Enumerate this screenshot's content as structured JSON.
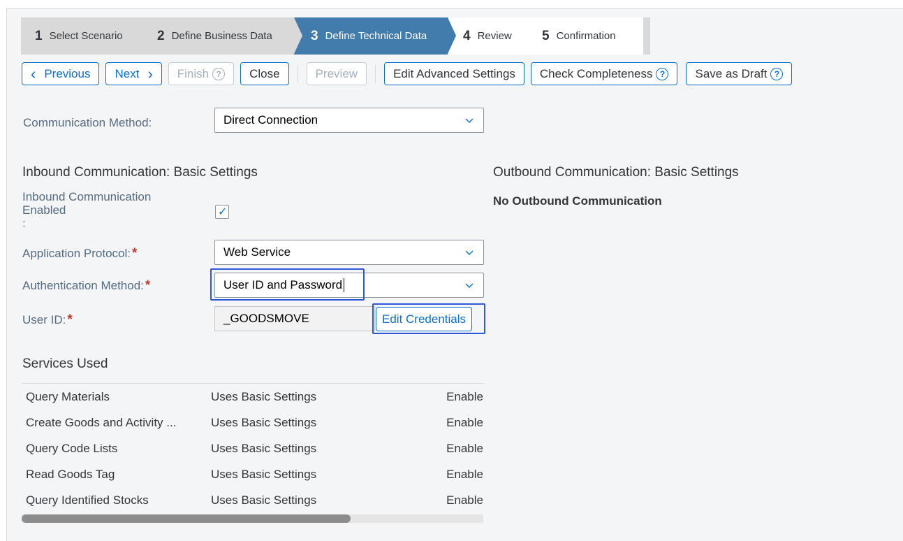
{
  "steps": [
    {
      "num": "1",
      "label": "Select Scenario"
    },
    {
      "num": "2",
      "label": "Define Business Data"
    },
    {
      "num": "3",
      "label": "Define Technical Data"
    },
    {
      "num": "4",
      "label": "Review"
    },
    {
      "num": "5",
      "label": "Confirmation"
    }
  ],
  "toolbar": {
    "previous": "Previous",
    "next": "Next",
    "finish": "Finish",
    "close": "Close",
    "preview": "Preview",
    "edit_advanced": "Edit Advanced Settings",
    "check_completeness": "Check Completeness",
    "save_draft": "Save as Draft"
  },
  "form": {
    "comm_method_label": "Communication Method:",
    "comm_method_value": "Direct Connection",
    "inbound_title": "Inbound Communication: Basic Settings",
    "inbound_enabled_label_1": "Inbound Communication",
    "inbound_enabled_label_2": "Enabled",
    "inbound_enabled_label_3": ":",
    "app_protocol_label": "Application Protocol:",
    "app_protocol_value": "Web Service",
    "auth_method_label": "Authentication Method:",
    "auth_method_value": "User ID and Password",
    "user_id_label": "User ID:",
    "user_id_value": "_GOODSMOVE",
    "edit_credentials": "Edit Credentials",
    "required_mark": "*"
  },
  "outbound": {
    "title": "Outbound Communication: Basic Settings",
    "value": "No Outbound Communication"
  },
  "services": {
    "title": "Services Used",
    "rows": [
      {
        "name": "Query Materials",
        "settings": "Uses Basic Settings",
        "status": "Enable"
      },
      {
        "name": "Create Goods and Activity ...",
        "settings": "Uses Basic Settings",
        "status": "Enable"
      },
      {
        "name": "Query Code Lists",
        "settings": "Uses Basic Settings",
        "status": "Enable"
      },
      {
        "name": "Read Goods Tag",
        "settings": "Uses Basic Settings",
        "status": "Enable"
      },
      {
        "name": "Query Identified Stocks",
        "settings": "Uses Basic Settings",
        "status": "Enable"
      }
    ]
  },
  "icons": {
    "help": "?",
    "check": "✓",
    "prev_chevron": "‹",
    "next_chevron": "›"
  },
  "colors": {
    "accent": "#0a6ed1",
    "active_step": "#427cac",
    "focus": "#2b58d6",
    "required": "#c0392b"
  }
}
